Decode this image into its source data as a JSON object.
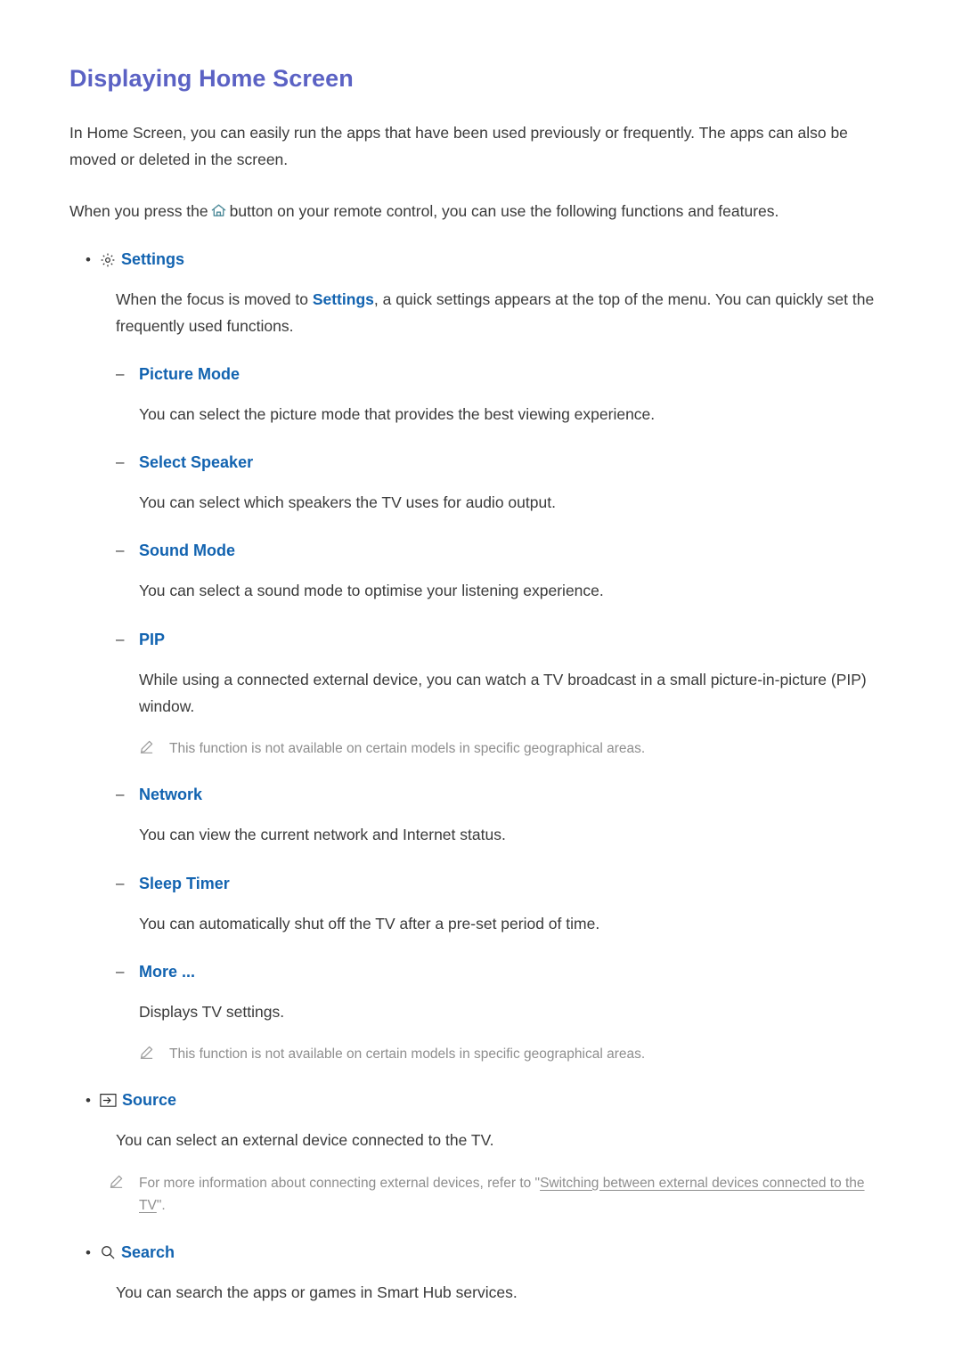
{
  "document": {
    "title": "Displaying Home Screen",
    "title_color": "#5b62c4",
    "link_color": "#1263b0",
    "note_color": "#8e8e8e",
    "intro_paragraph": "In Home Screen, you can easily run the apps that have been used previously or frequently. The apps can also be moved or deleted in the screen.",
    "press_sentence_before": "When you press the",
    "press_sentence_after": "button on your remote control, you can use the following functions and features.",
    "home_icon_name": "home-icon"
  },
  "settings_section": {
    "icon": "gear-icon",
    "label": "Settings",
    "description_before": "When the focus is moved to",
    "description_link": "Settings",
    "description_after": ", a quick settings appears at the top of the menu. You can quickly set the frequently used functions.",
    "items": [
      {
        "label": "Picture Mode",
        "description": "You can select the picture mode that provides the best viewing experience.",
        "notes": []
      },
      {
        "label": "Select Speaker",
        "description": "You can select which speakers the TV uses for audio output.",
        "notes": []
      },
      {
        "label": "Sound Mode",
        "description": "You can select a sound mode to optimise your listening experience.",
        "notes": []
      },
      {
        "label": "PIP",
        "description": "While using a connected external device, you can watch a TV broadcast in a small picture-in-picture (PIP) window.",
        "notes": [
          "This function is not available on certain models in specific geographical areas."
        ]
      },
      {
        "label": "Network",
        "description": "You can view the current network and Internet status.",
        "notes": []
      },
      {
        "label": "Sleep Timer",
        "description": "You can automatically shut off the TV after a pre-set period of time.",
        "notes": []
      },
      {
        "label": "More ...",
        "description": "Displays TV settings.",
        "notes": [
          "This function is not available on certain models in specific geographical areas."
        ]
      }
    ]
  },
  "source_section": {
    "icon": "source-input-icon",
    "label": "Source",
    "description": "You can select an external device connected to the TV.",
    "note": {
      "text_before": "For more information about connecting external devices, refer to \"",
      "link_text": "Switching between external devices connected to the TV",
      "text_after": "\"."
    }
  },
  "search_section": {
    "icon": "search-icon",
    "label": "Search",
    "description": "You can search the apps or games in Smart Hub services."
  },
  "markers": {
    "bullet": "•",
    "dash": "–"
  }
}
